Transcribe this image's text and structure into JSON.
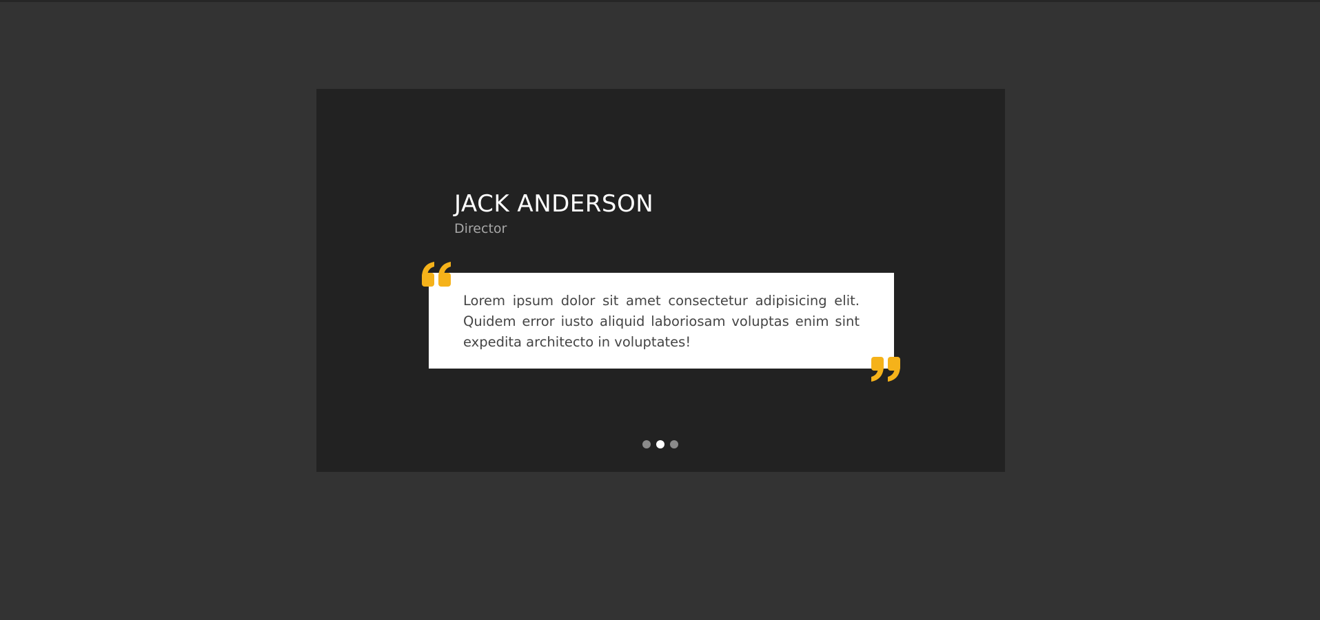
{
  "testimonial": {
    "name": "JACK ANDERSON",
    "role": "Director",
    "quote": "Lorem ipsum dolor sit amet consectetur adipisicing elit. Quidem error iusto aliquid laboriosam voluptas enim sint expedita architecto in voluptates!"
  },
  "pagination": {
    "count": 3,
    "active_index": 1
  },
  "colors": {
    "page_background": "#333333",
    "card_background": "#222222",
    "accent": "#f5b21a",
    "quote_box": "#ffffff"
  },
  "icons": {
    "open_quote": "open-quote-icon",
    "close_quote": "close-quote-icon"
  }
}
